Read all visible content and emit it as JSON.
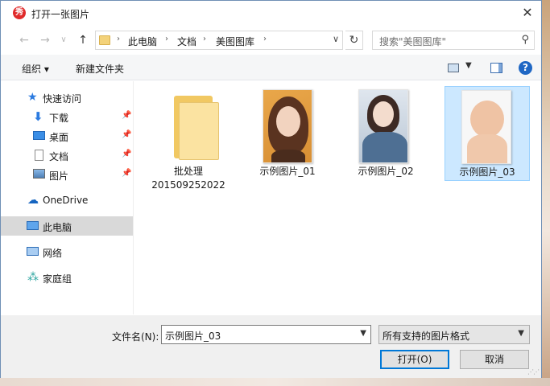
{
  "window": {
    "title": "打开一张图片",
    "app_icon_char": "秀",
    "close_glyph": "✕"
  },
  "navigation": {
    "back_glyph": "←",
    "forward_glyph": "→",
    "history_glyph": "∨",
    "up_glyph": "↑",
    "breadcrumb": [
      "此电脑",
      "文档",
      "美图图库"
    ],
    "breadcrumb_sep": "›",
    "refresh_glyph": "↻",
    "search_placeholder": "搜索\"美图图库\""
  },
  "toolbar": {
    "organize_label": "组织 ▾",
    "new_folder_label": "新建文件夹",
    "help_label": "?"
  },
  "sidebar": {
    "quick_access": "快速访问",
    "quick_items": [
      {
        "label": "下载",
        "pin": "📌"
      },
      {
        "label": "桌面",
        "pin": "📌"
      },
      {
        "label": "文档",
        "pin": "📌"
      },
      {
        "label": "图片",
        "pin": "📌"
      }
    ],
    "onedrive": "OneDrive",
    "this_pc": "此电脑",
    "network": "网络",
    "homegroup": "家庭组"
  },
  "files": [
    {
      "name_line1": "批处理",
      "name_line2": "201509252022",
      "type": "folder"
    },
    {
      "name_line1": "示例图片_01",
      "type": "image"
    },
    {
      "name_line1": "示例图片_02",
      "type": "image"
    },
    {
      "name_line1": "示例图片_03",
      "type": "image",
      "selected": true
    }
  ],
  "footer": {
    "filename_label": "文件名(N):",
    "filename_value": "示例图片_03",
    "filetype_value": "所有支持的图片格式",
    "open_label": "打开(O)",
    "cancel_label": "取消"
  },
  "colors": {
    "selection": "#cce8ff",
    "accent": "#0078d7"
  }
}
